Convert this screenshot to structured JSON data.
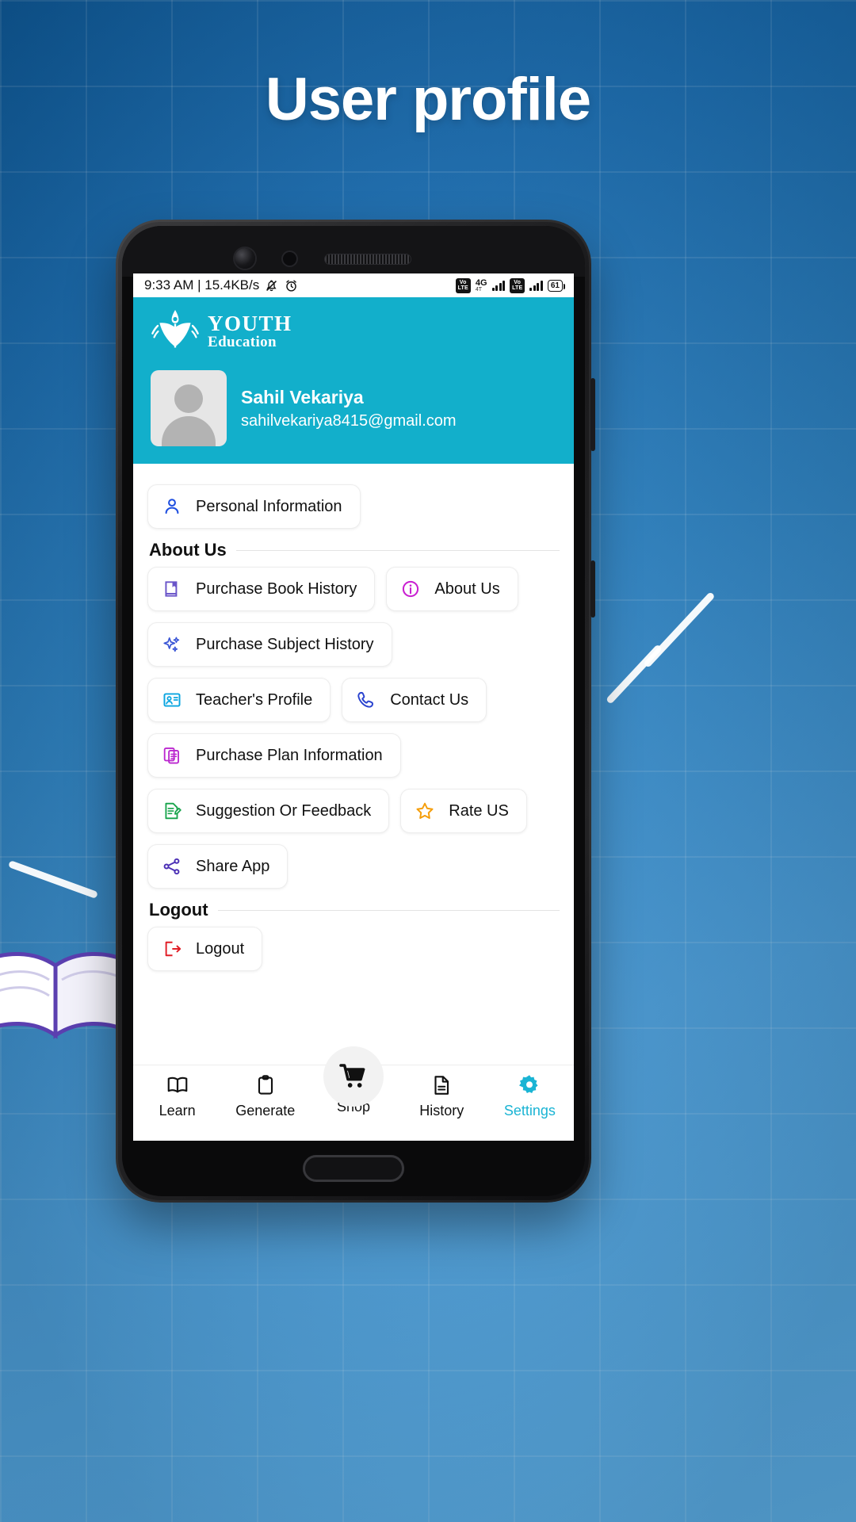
{
  "poster": {
    "title": "User profile",
    "background_color": "#2e86c8",
    "title_color": "#ffffff"
  },
  "phone": {
    "statusbar": {
      "time_and_speed": "9:33 AM | 15.4KB/s",
      "mute_icon": "bell-muted-icon",
      "alarm_icon": "alarm-clock-icon",
      "volte_line1": "Vo",
      "volte_line2": "LTE",
      "network_type": "4G",
      "network_sub": "4T",
      "battery_level": "61"
    },
    "header": {
      "brand_title": "YOUTH",
      "brand_subtitle": "Education",
      "logo_icon": "pen-book-logo-icon",
      "background_color": "#12AFCB",
      "profile": {
        "avatar_icon": "default-user-avatar-icon",
        "name": "Sahil Vekariya",
        "email": "sahilvekariya8415@gmail.com"
      }
    },
    "menu": {
      "rows": [
        {
          "items": [
            {
              "label": "Personal Information",
              "icon": "person-outline-icon",
              "color": "#1f4fe0"
            }
          ]
        }
      ],
      "sections": [
        {
          "heading": "About Us",
          "rows": [
            {
              "items": [
                {
                  "label": "Purchase Book History",
                  "icon": "book-bookmark-icon",
                  "color": "#6a55c9"
                },
                {
                  "label": "About Us",
                  "icon": "info-circle-icon",
                  "color": "#c91fd1"
                }
              ]
            },
            {
              "items": [
                {
                  "label": "Purchase Subject History",
                  "icon": "sparkles-icon",
                  "color": "#3c57d6"
                }
              ]
            },
            {
              "items": [
                {
                  "label": "Teacher's Profile",
                  "icon": "id-card-icon",
                  "color": "#0aa5e0"
                },
                {
                  "label": "Contact Us",
                  "icon": "phone-call-icon",
                  "color": "#2a43cf"
                }
              ]
            },
            {
              "items": [
                {
                  "label": "Purchase Plan Information",
                  "icon": "clipboard-copy-icon",
                  "color": "#bb27cf"
                }
              ]
            },
            {
              "items": [
                {
                  "label": "Suggestion Or Feedback",
                  "icon": "document-edit-icon",
                  "color": "#16a34a"
                },
                {
                  "label": "Rate US",
                  "icon": "star-outline-icon",
                  "color": "#f59e0b"
                }
              ]
            },
            {
              "items": [
                {
                  "label": "Share App",
                  "icon": "share-nodes-icon",
                  "color": "#4b2fb5"
                }
              ]
            }
          ]
        },
        {
          "heading": "Logout",
          "rows": [
            {
              "items": [
                {
                  "label": "Logout",
                  "icon": "logout-arrow-icon",
                  "color": "#e11d26"
                }
              ]
            }
          ]
        }
      ]
    },
    "bottom_nav": {
      "active_color": "#1AB4D4",
      "items": [
        {
          "label": "Learn",
          "icon": "open-book-icon",
          "active": false
        },
        {
          "label": "Generate",
          "icon": "clipboard-icon",
          "active": false
        },
        {
          "label": "Shop",
          "icon": "shopping-cart-icon",
          "active": false
        },
        {
          "label": "History",
          "icon": "document-icon",
          "active": false
        },
        {
          "label": "Settings",
          "icon": "gear-icon",
          "active": true
        }
      ]
    }
  }
}
